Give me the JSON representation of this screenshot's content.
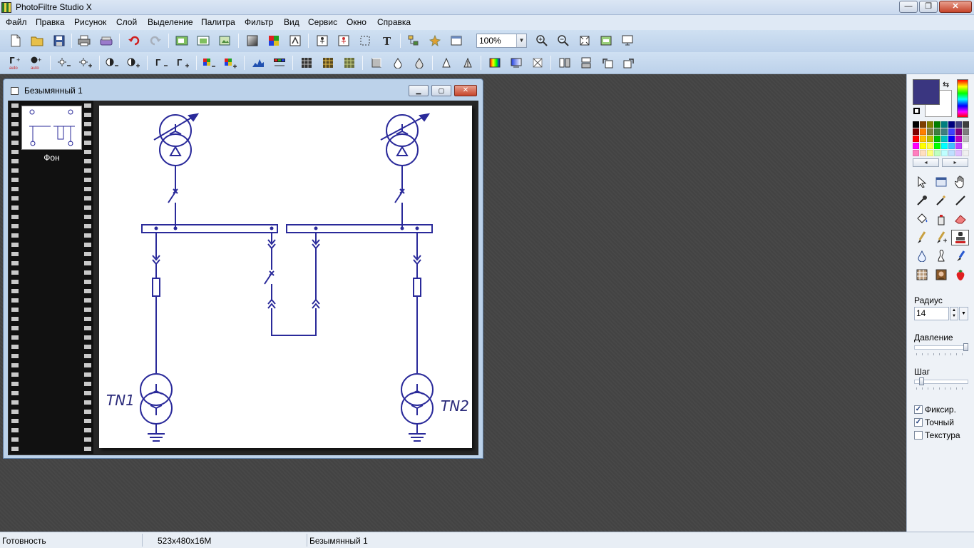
{
  "app": {
    "title": "PhotoFiltre Studio X"
  },
  "window_controls": {
    "minimize": "—",
    "maximize": "❐",
    "close": "✕"
  },
  "menu": [
    "Файл",
    "Правка",
    "Рисунок",
    "Слой",
    "Выделение",
    "Палитра",
    "Фильтр",
    "Вид",
    "Сервис",
    "Окно",
    "Справка"
  ],
  "toolbar": {
    "zoom_value": "100%"
  },
  "document": {
    "title": "Безымянный 1",
    "layer_label": "Фон",
    "diagram": {
      "label_left": "TN1",
      "label_right": "TN2"
    }
  },
  "colors": {
    "foreground": "#3a3680",
    "background": "#ffffff"
  },
  "palette": [
    "#000000",
    "#7f3f00",
    "#7f7f00",
    "#007f00",
    "#007f7f",
    "#00007f",
    "#3f3f7f",
    "#3f3f3f",
    "#7f0000",
    "#ff7f00",
    "#7f7f3f",
    "#3f7f3f",
    "#3f7f7f",
    "#3f3fff",
    "#7f007f",
    "#7f7f7f",
    "#ff0000",
    "#ffbf00",
    "#bfbf00",
    "#00bf00",
    "#00bfbf",
    "#0000ff",
    "#bf00bf",
    "#bfbfbf",
    "#ff00ff",
    "#ffff00",
    "#ffff3f",
    "#00ff00",
    "#00ffff",
    "#3fbfff",
    "#bf3fff",
    "#ffffff",
    "#ff7fbf",
    "#ffdfbf",
    "#ffff7f",
    "#bfffbf",
    "#bfffff",
    "#bfdfff",
    "#dfbfff",
    "#f0f0f0"
  ],
  "tool_options": {
    "radius_label": "Радиус",
    "radius_value": "14",
    "pressure_label": "Давление",
    "pressure_level": 1.0,
    "step_label": "Шаг",
    "step_level": 0.1,
    "checkboxes": [
      {
        "label": "Фиксир.",
        "checked": true
      },
      {
        "label": "Точный",
        "checked": true
      },
      {
        "label": "Текстура",
        "checked": false
      }
    ]
  },
  "status": {
    "state": "Готовность",
    "image_info": "523x480x16M",
    "file_name": "Безымянный 1"
  }
}
